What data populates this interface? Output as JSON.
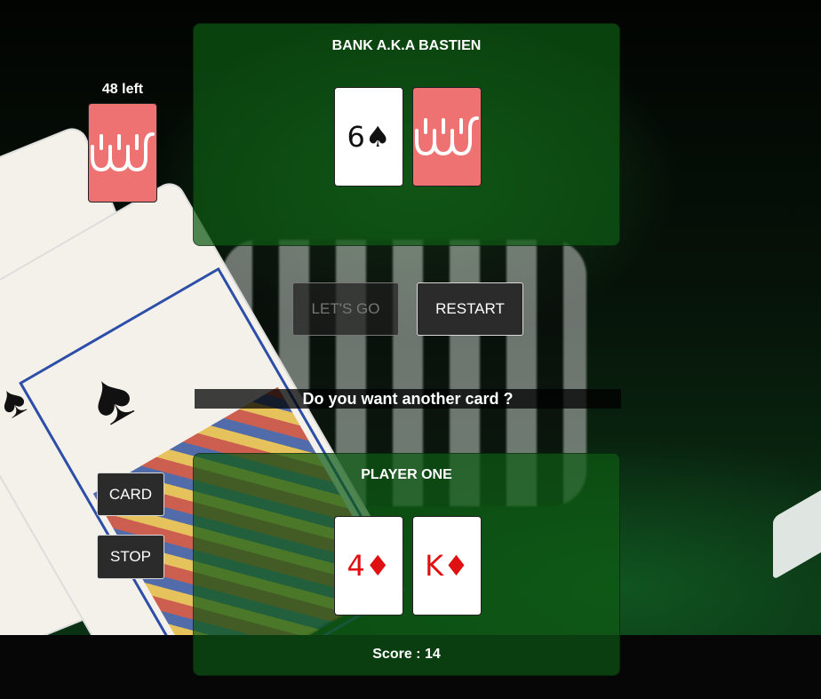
{
  "deck": {
    "remaining_label": "48 left",
    "back_color": "#ef7272"
  },
  "bank": {
    "title": "BANK A.K.A BASTIEN",
    "cards": [
      {
        "face": "6♠",
        "suit_color": "black",
        "hidden": false
      },
      {
        "face": "",
        "hidden": true
      }
    ]
  },
  "controls": {
    "letsgo_label": "LET'S GO",
    "letsgo_disabled": true,
    "restart_label": "RESTART",
    "card_label": "CARD",
    "stop_label": "STOP"
  },
  "prompt": {
    "question": "Do you want another card ?"
  },
  "player": {
    "title": "PLAYER ONE",
    "cards": [
      {
        "face": "4♦",
        "suit_color": "red",
        "hidden": false
      },
      {
        "face": "K♦",
        "suit_color": "red",
        "hidden": false
      }
    ],
    "score_label": "Score : 14"
  },
  "colors": {
    "panel": "#0e5a14",
    "card_red": "#e01010",
    "card_back": "#ef7272"
  }
}
